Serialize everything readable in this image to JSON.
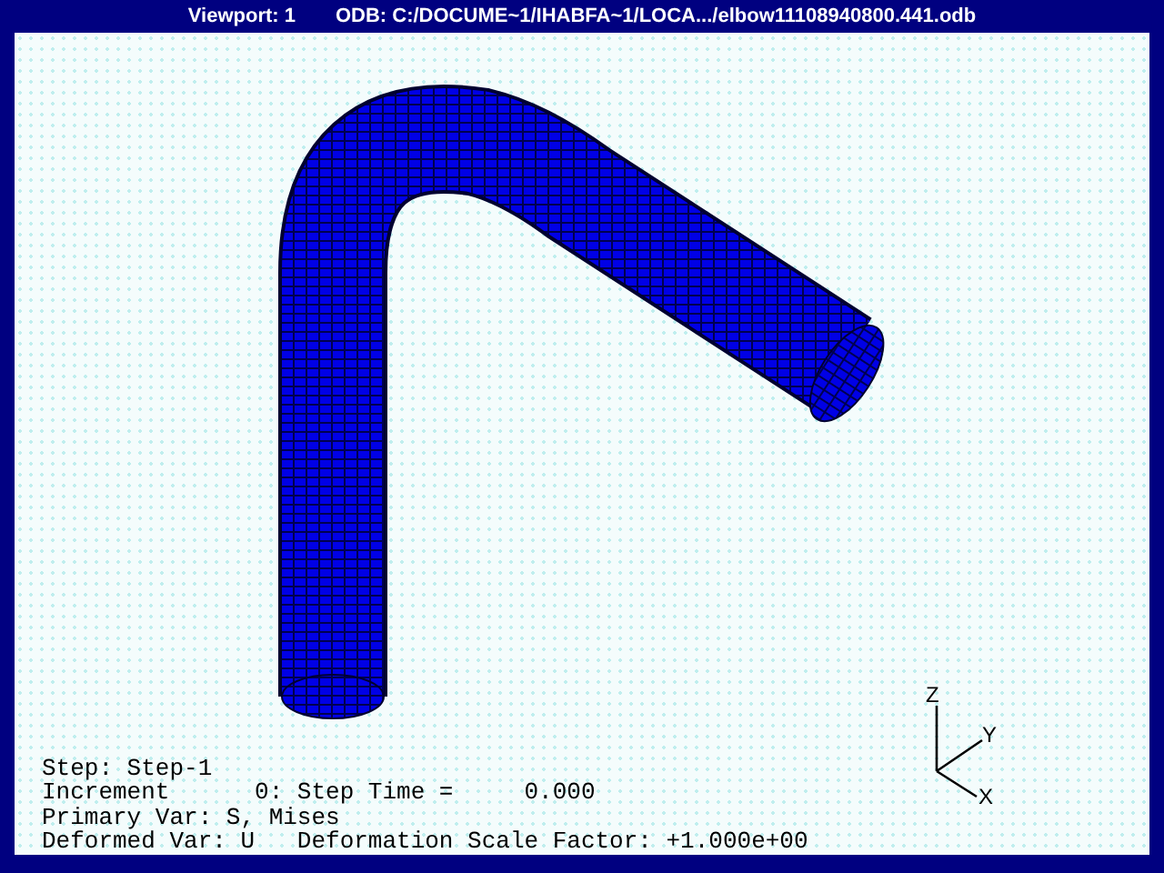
{
  "title_bar": {
    "viewport": "Viewport: 1",
    "odb": "ODB: C:/DOCUME~1/IHABFA~1/LOCA.../elbow11108940800.441.odb"
  },
  "state_block": [
    "Step: Step-1",
    "Increment      0: Step Time =     0.000",
    "Primary Var: S, Mises",
    "Deformed Var: U   Deformation Scale Factor: +1.000e+00"
  ],
  "triad": {
    "z": "Z",
    "y": "Y",
    "x": "X"
  }
}
